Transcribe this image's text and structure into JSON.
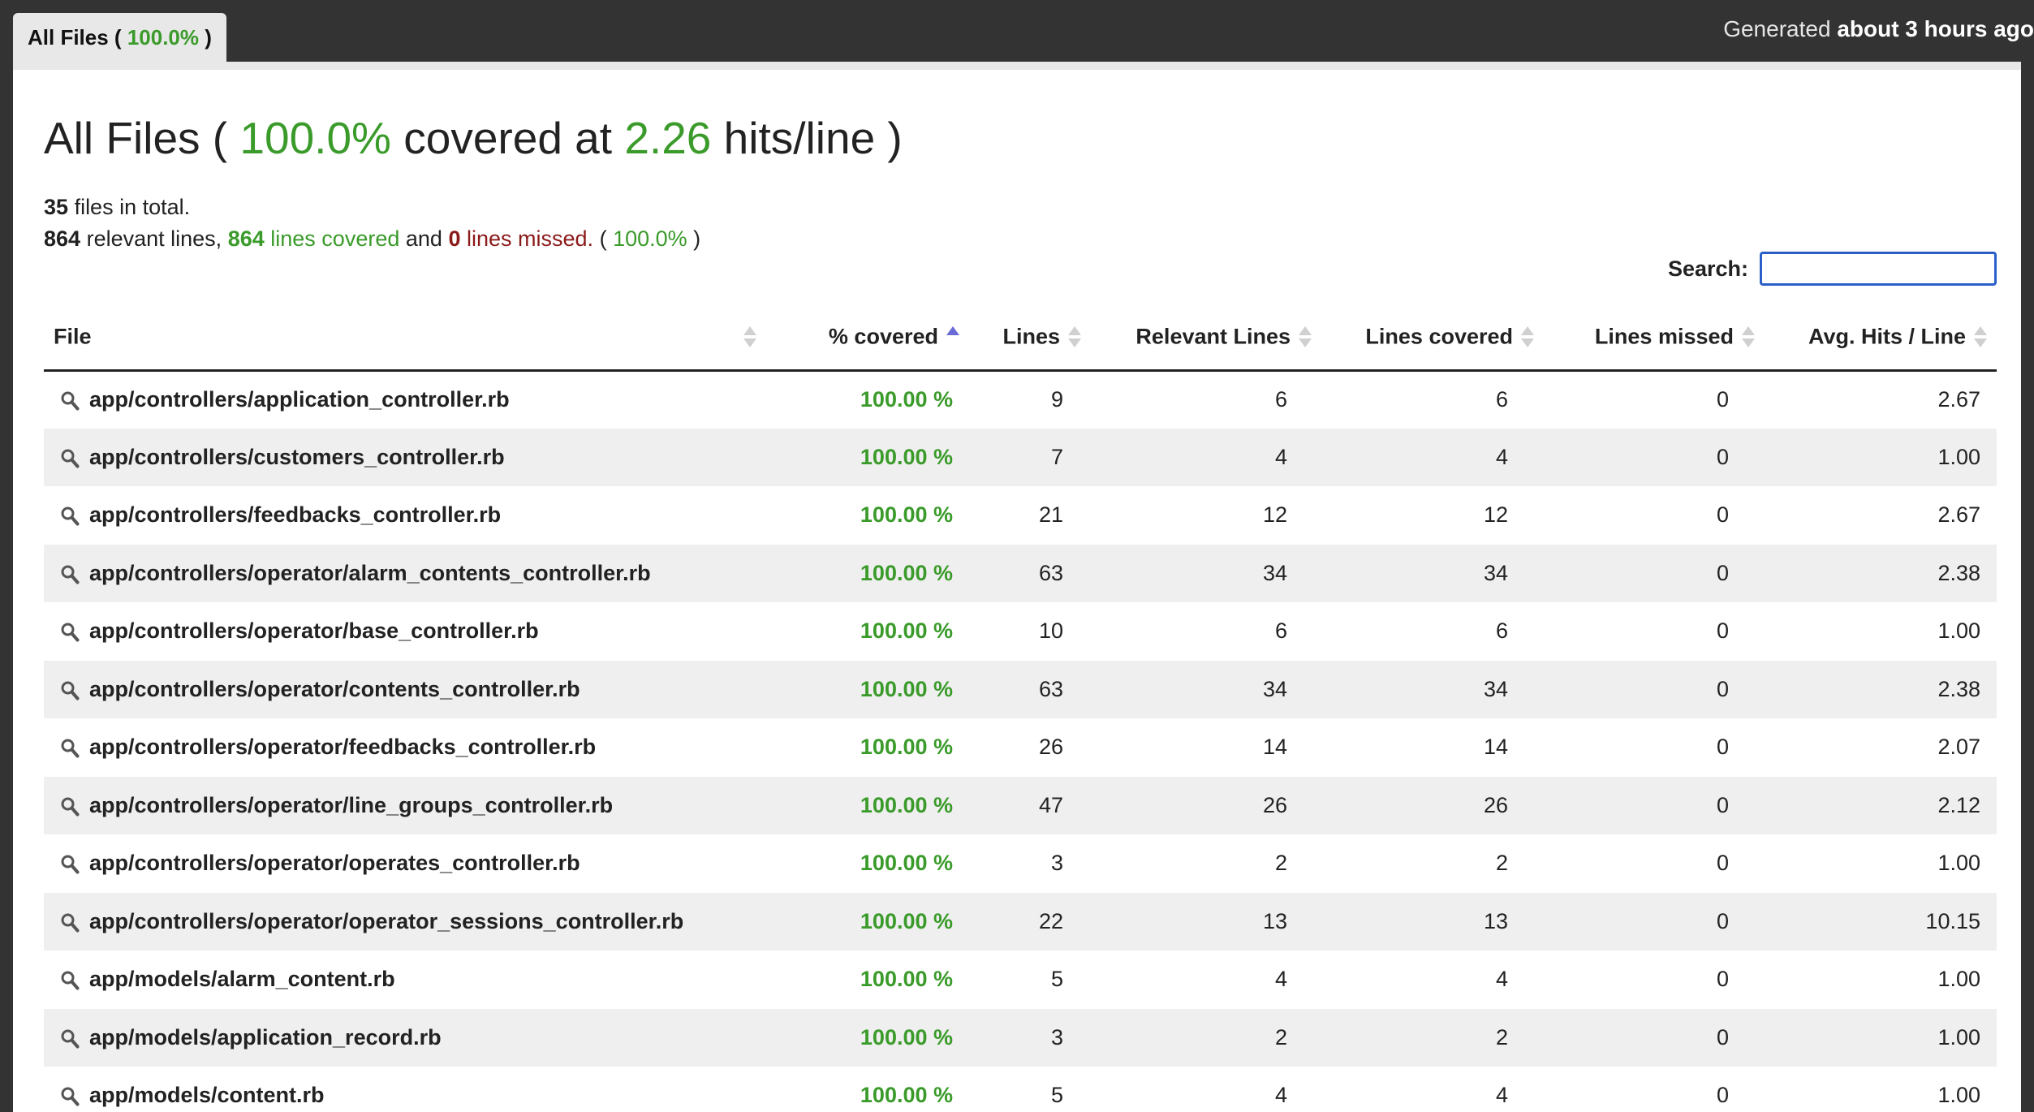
{
  "tab": {
    "label": "All Files",
    "pct": "100.0%"
  },
  "generated": {
    "prefix": "Generated",
    "time": "about 3 hours ago"
  },
  "heading": {
    "prefix": "All Files (",
    "pct": "100.0%",
    "mid": "covered at",
    "hits": "2.26",
    "suffix": "hits/line )"
  },
  "summary": {
    "files_count": "35",
    "files_text": "files in total.",
    "relevant": "864",
    "relevant_text": "relevant lines,",
    "covered": "864",
    "covered_text": "lines covered",
    "and_text": "and",
    "missed": "0",
    "missed_text": "lines missed.",
    "pct": "100.0%"
  },
  "search": {
    "label": "Search:",
    "value": "",
    "placeholder": ""
  },
  "columns": [
    "File",
    "% covered",
    "Lines",
    "Relevant Lines",
    "Lines covered",
    "Lines missed",
    "Avg. Hits / Line"
  ],
  "rows": [
    {
      "file": "app/controllers/application_controller.rb",
      "pct": "100.00 %",
      "lines": "9",
      "relevant": "6",
      "covered": "6",
      "missed": "0",
      "avg": "2.67"
    },
    {
      "file": "app/controllers/customers_controller.rb",
      "pct": "100.00 %",
      "lines": "7",
      "relevant": "4",
      "covered": "4",
      "missed": "0",
      "avg": "1.00"
    },
    {
      "file": "app/controllers/feedbacks_controller.rb",
      "pct": "100.00 %",
      "lines": "21",
      "relevant": "12",
      "covered": "12",
      "missed": "0",
      "avg": "2.67"
    },
    {
      "file": "app/controllers/operator/alarm_contents_controller.rb",
      "pct": "100.00 %",
      "lines": "63",
      "relevant": "34",
      "covered": "34",
      "missed": "0",
      "avg": "2.38"
    },
    {
      "file": "app/controllers/operator/base_controller.rb",
      "pct": "100.00 %",
      "lines": "10",
      "relevant": "6",
      "covered": "6",
      "missed": "0",
      "avg": "1.00"
    },
    {
      "file": "app/controllers/operator/contents_controller.rb",
      "pct": "100.00 %",
      "lines": "63",
      "relevant": "34",
      "covered": "34",
      "missed": "0",
      "avg": "2.38"
    },
    {
      "file": "app/controllers/operator/feedbacks_controller.rb",
      "pct": "100.00 %",
      "lines": "26",
      "relevant": "14",
      "covered": "14",
      "missed": "0",
      "avg": "2.07"
    },
    {
      "file": "app/controllers/operator/line_groups_controller.rb",
      "pct": "100.00 %",
      "lines": "47",
      "relevant": "26",
      "covered": "26",
      "missed": "0",
      "avg": "2.12"
    },
    {
      "file": "app/controllers/operator/operates_controller.rb",
      "pct": "100.00 %",
      "lines": "3",
      "relevant": "2",
      "covered": "2",
      "missed": "0",
      "avg": "1.00"
    },
    {
      "file": "app/controllers/operator/operator_sessions_controller.rb",
      "pct": "100.00 %",
      "lines": "22",
      "relevant": "13",
      "covered": "13",
      "missed": "0",
      "avg": "10.15"
    },
    {
      "file": "app/models/alarm_content.rb",
      "pct": "100.00 %",
      "lines": "5",
      "relevant": "4",
      "covered": "4",
      "missed": "0",
      "avg": "1.00"
    },
    {
      "file": "app/models/application_record.rb",
      "pct": "100.00 %",
      "lines": "3",
      "relevant": "2",
      "covered": "2",
      "missed": "0",
      "avg": "1.00"
    },
    {
      "file": "app/models/content.rb",
      "pct": "100.00 %",
      "lines": "5",
      "relevant": "4",
      "covered": "4",
      "missed": "0",
      "avg": "1.00"
    }
  ],
  "colors": {
    "green": "#3a9b2a",
    "red": "#8b1a1a",
    "topbar": "#333333",
    "search_border": "#2a5fc9"
  },
  "icons": {
    "file_row": "magnifier-icon",
    "sort": "sort-arrows-icon"
  }
}
